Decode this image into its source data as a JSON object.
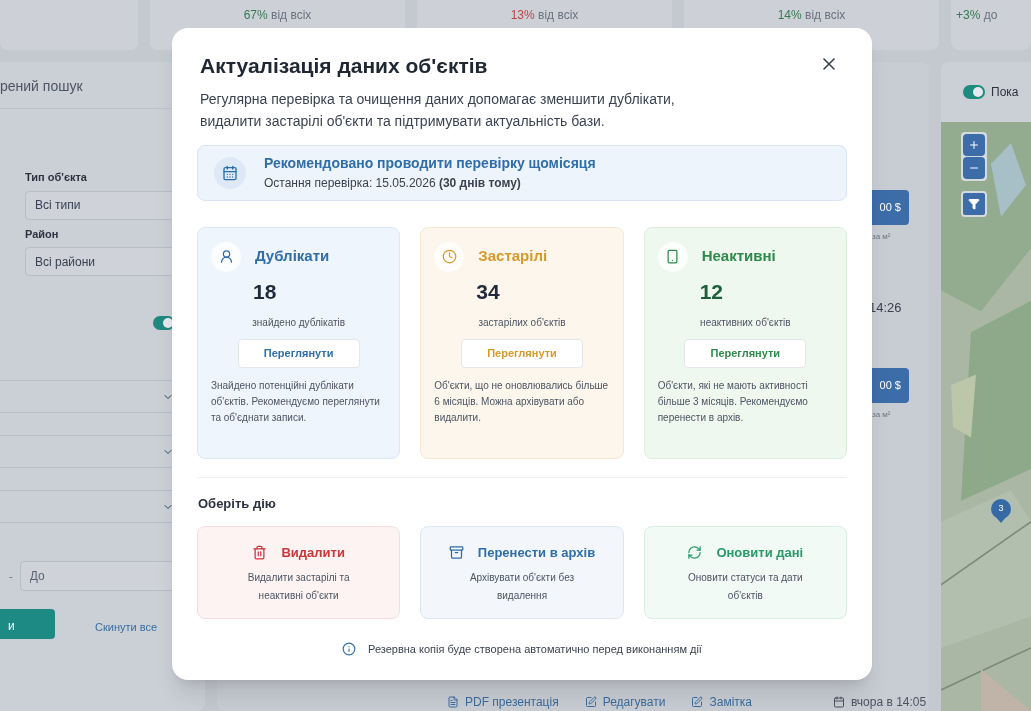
{
  "stats": [
    {
      "value": "67%",
      "text": " від всіх",
      "color": "#357a52"
    },
    {
      "value": "13%",
      "text": " від всіх",
      "color": "#b8434a"
    },
    {
      "value": "14%",
      "text": " від всіх",
      "color": "#357a52"
    },
    {
      "value": "+3%",
      "text": " до",
      "color": "#357a52"
    }
  ],
  "sidebar": {
    "heading": "рений пошук",
    "filters": [
      {
        "label": "Тип об'єкта",
        "value": "Всі типи"
      },
      {
        "label": "Район",
        "value": "Всі райони"
      }
    ],
    "toggle_on": true,
    "range_to": {
      "placeholder": "До"
    },
    "range_dash": "-",
    "apply_button": "и",
    "reset_link": "Скинути все"
  },
  "listing": [
    {
      "price": "00 $",
      "per_m2": "за м²"
    },
    {
      "price": "00 $",
      "per_m2": "за м²"
    }
  ],
  "listing_time": "14:26",
  "bottom_bar": [
    {
      "kind": "pdf",
      "label": "PDF презентація"
    },
    {
      "kind": "edit",
      "label": "Редагувати"
    },
    {
      "kind": "note",
      "label": "Замітка"
    },
    {
      "kind": "date",
      "label": "вчора в 14:05"
    }
  ],
  "map": {
    "toggle_on": true,
    "toggle_label": "Пока",
    "marker": "3"
  },
  "modal": {
    "title": "Актуалізація даних об'єктів",
    "description": "Регулярна перевірка та очищення даних допомагає зменшити дублікати, видалити застарілі об'єкти та підтримувати актуальність бази.",
    "banner": {
      "title": "Рекомендовано проводити перевірку щомісяця",
      "subtitle": "Остання перевірка: 15.05.2026 **(30 днів тому)**"
    },
    "cards": [
      {
        "kind": "duplicates",
        "title": "Дублікати",
        "count": "18",
        "caption": "знайдено дублікатів",
        "button": "Переглянути",
        "text": "Знайдено потенційні дублікати об'єктів. Рекомендуємо переглянути та об'єднати записи."
      },
      {
        "kind": "outdated",
        "title": "Застарілі",
        "count": "34",
        "caption": "застарілих об'єктів",
        "button": "Переглянути",
        "text": "Об'єкти, що не оновлювались більше 6 місяців. Можна архівувати або видалити."
      },
      {
        "kind": "inactive",
        "title": "Неактивні",
        "count": "12",
        "caption": "неактивних об'єктів",
        "button": "Переглянути",
        "text": "Об'єкти, які не мають активності більше 3 місяців. Рекомендуємо перенести в архів."
      }
    ],
    "actions_heading": "Оберіть дію",
    "actions": [
      {
        "kind": "delete",
        "title": "Видалити",
        "text": "Видалити застарілі та неактивні об'єкти"
      },
      {
        "kind": "archive",
        "title": "Перенести в архів",
        "text": "Архівувати об'єкти без видалення"
      },
      {
        "kind": "refresh",
        "title": "Оновити дані",
        "text": "Оновити статуси та дати об'єктів"
      }
    ],
    "footer_note": "Резервна копія буде створена автоматично перед виконанням дії"
  }
}
